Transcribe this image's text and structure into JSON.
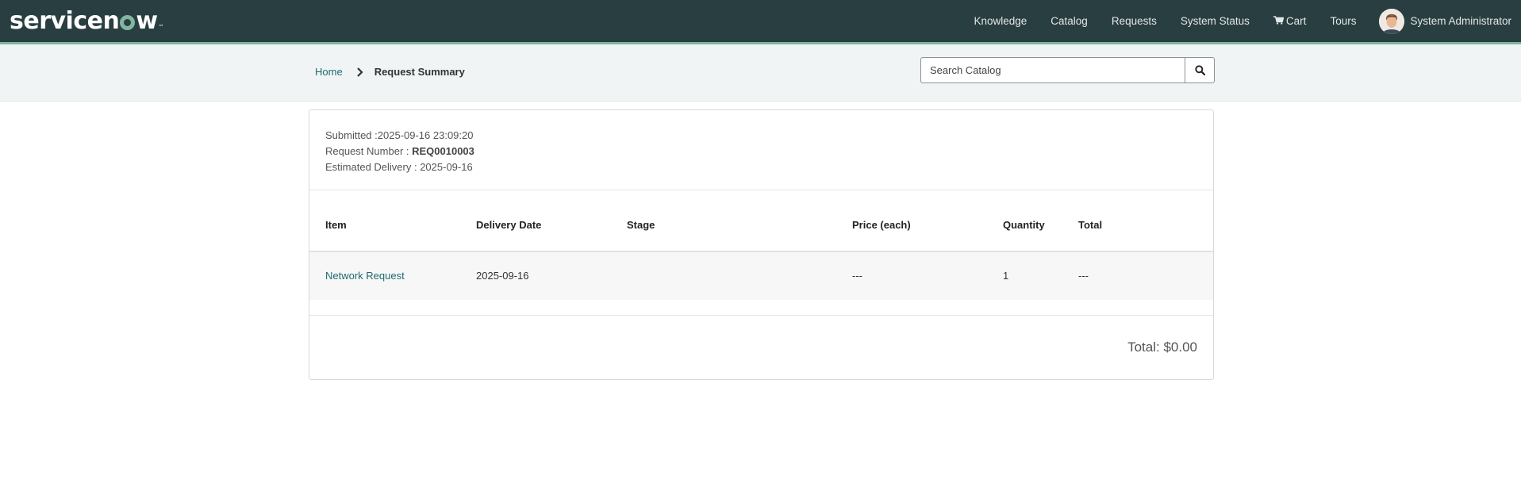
{
  "header": {
    "logo": {
      "pre": "servicen",
      "post": "w",
      "tm": "™"
    },
    "nav": {
      "knowledge": "Knowledge",
      "catalog": "Catalog",
      "requests": "Requests",
      "system_status": "System Status",
      "cart": "Cart",
      "tours": "Tours"
    },
    "user_name": "System Administrator",
    "colors": {
      "bar": "#293e40",
      "accent": "#81b5a1"
    }
  },
  "breadcrumb": {
    "home": "Home",
    "current": "Request Summary"
  },
  "search": {
    "placeholder": "Search Catalog",
    "icon": "search-icon"
  },
  "summary": {
    "submitted_label": "Submitted :",
    "submitted_value": "2025-09-16 23:09:20",
    "request_number_label": "Request Number : ",
    "request_number_value": "REQ0010003",
    "estimated_delivery_label": "Estimated Delivery : ",
    "estimated_delivery_value": "2025-09-16"
  },
  "table": {
    "columns": {
      "item": "Item",
      "delivery_date": "Delivery Date",
      "stage": "Stage",
      "price": "Price (each)",
      "quantity": "Quantity",
      "total": "Total"
    },
    "rows": [
      {
        "item": "Network Request",
        "delivery_date": "2025-09-16",
        "stage": "",
        "price": "---",
        "quantity": "1",
        "total": "---"
      }
    ]
  },
  "grand_total": "Total: $0.00"
}
